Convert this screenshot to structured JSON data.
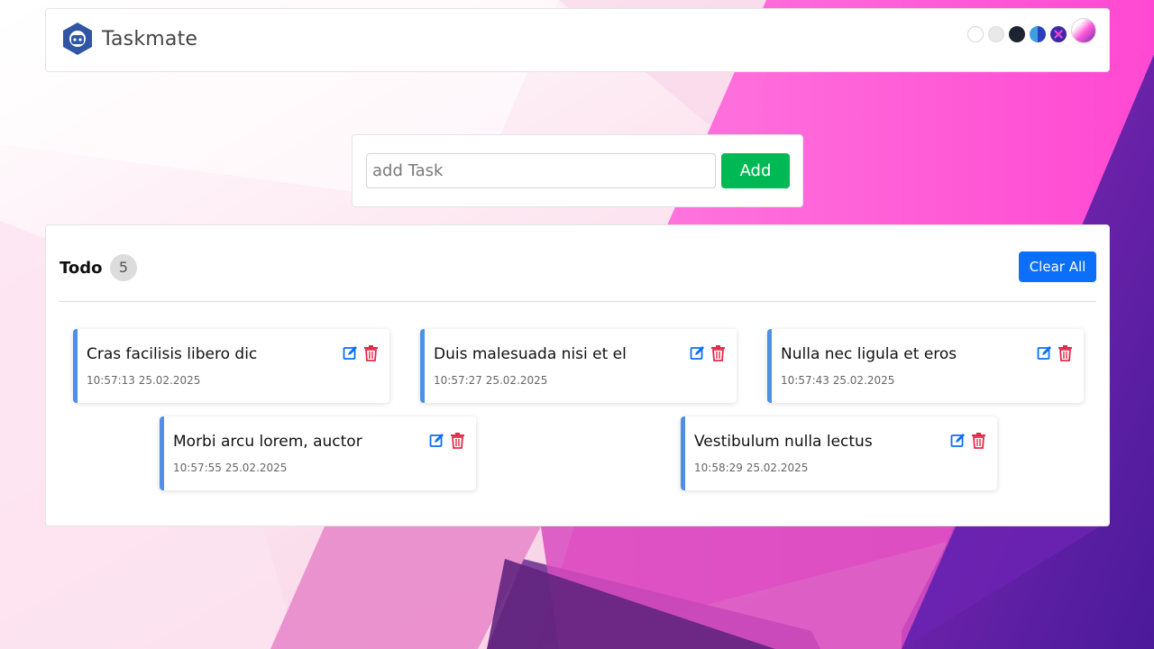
{
  "app": {
    "name": "Taskmate"
  },
  "colors": {
    "accent_blue": "#0b6ff7",
    "add_green": "#00b955",
    "card_border_blue": "#4f8fe8",
    "delete_red": "#e02b4a"
  },
  "header": {
    "themes": [
      {
        "name": "light-theme"
      },
      {
        "name": "gray-theme"
      },
      {
        "name": "dark-theme"
      },
      {
        "name": "blue-theme"
      },
      {
        "name": "x-theme"
      },
      {
        "name": "gradient-theme"
      }
    ]
  },
  "add_task": {
    "placeholder": "add Task",
    "value": "",
    "button_label": "Add"
  },
  "todo": {
    "title": "Todo",
    "count": "5",
    "clear_label": "Clear All",
    "tasks": [
      {
        "text": "Cras facilisis libero dic",
        "time": "10:57:13 25.02.2025",
        "edit_icon": "edit-icon",
        "delete_icon": "trash-icon"
      },
      {
        "text": "Duis malesuada nisi et el",
        "time": "10:57:27 25.02.2025",
        "edit_icon": "edit-icon",
        "delete_icon": "trash-icon"
      },
      {
        "text": "Nulla nec ligula et eros",
        "time": "10:57:43 25.02.2025",
        "edit_icon": "edit-icon",
        "delete_icon": "trash-icon"
      },
      {
        "text": "Morbi arcu lorem, auctor",
        "time": "10:57:55 25.02.2025",
        "edit_icon": "edit-icon",
        "delete_icon": "trash-icon"
      },
      {
        "text": "Vestibulum nulla lectus",
        "time": "10:58:29 25.02.2025",
        "edit_icon": "edit-icon",
        "delete_icon": "trash-icon"
      }
    ]
  }
}
